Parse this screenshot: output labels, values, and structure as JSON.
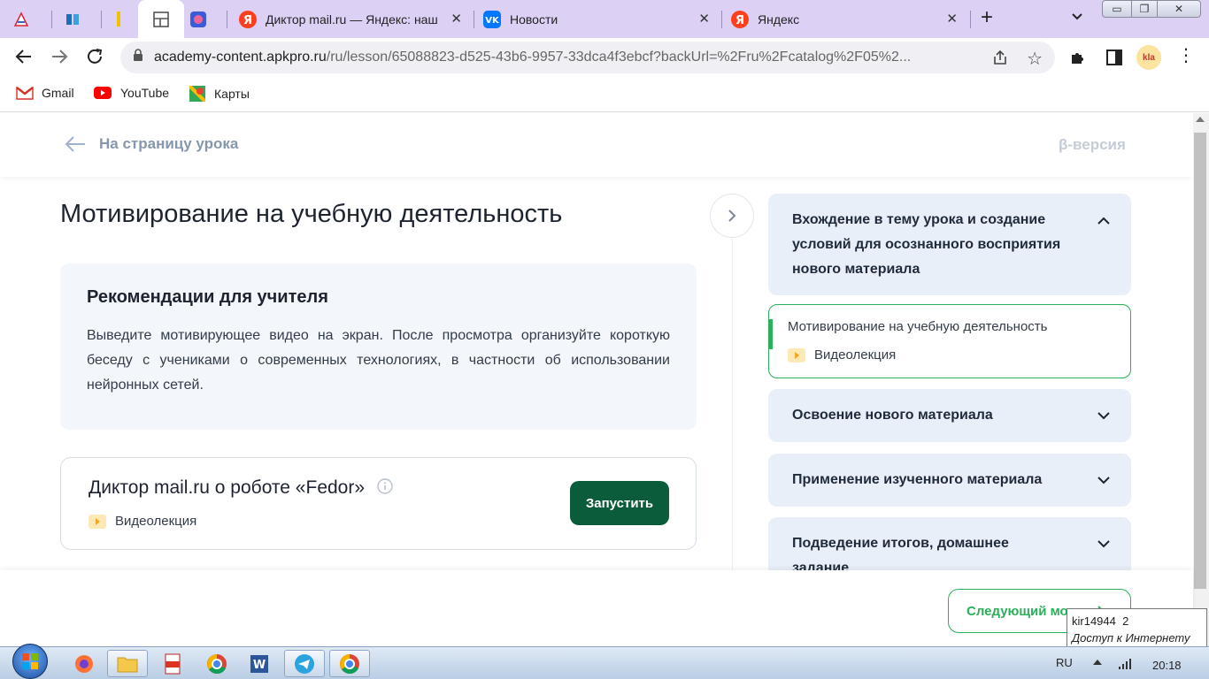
{
  "browser": {
    "tabs": [
      {
        "title": "",
        "icon": "app-icon"
      },
      {
        "title": "",
        "icon": "book-icon"
      },
      {
        "title": "",
        "icon": "pencil-icon"
      },
      {
        "title": "",
        "icon": "layout-icon"
      },
      {
        "title": "",
        "icon": "image-icon"
      },
      {
        "title": "Диктор mail.ru — Яндекс: наш",
        "icon": "yandex-icon"
      },
      {
        "title": "Новости",
        "icon": "vk-icon"
      },
      {
        "title": "Яндекс",
        "icon": "yandex-icon"
      }
    ],
    "new_tab": "+",
    "url_host": "academy-content.apkpro.ru",
    "url_path": "/ru/lesson/65088823-d525-43b6-9957-33dca4f3ebcf?backUrl=%2Fru%2Fcatalog%2F05%2...",
    "bookmarks": [
      "Gmail",
      "YouTube",
      "Карты"
    ],
    "profile_badge": "kla"
  },
  "header": {
    "back_link": "На страницу урока",
    "beta": "β-версия"
  },
  "lesson": {
    "title": "Мотивирование на учебную деятельность",
    "recommendations": {
      "heading": "Рекомендации для учителя",
      "text": "Выведите мотивирующее видео на экран. После просмотра организуйте короткую беседу с учениками о современных технологиях, в частности об использовании нейронных сетей."
    },
    "resource": {
      "title": "Диктор mail.ru о роботе «Fedor»",
      "type": "Видеолекция",
      "button": "Запустить"
    }
  },
  "sidebar": {
    "sections": [
      {
        "title": "Вхождение в тему урока и создание условий для осознанного восприятия нового материала",
        "expanded": true
      },
      {
        "title": "Освоение нового материала",
        "expanded": false
      },
      {
        "title": "Применение изученного материала",
        "expanded": false
      },
      {
        "title": "Подведение итогов, домашнее задание",
        "expanded": false
      }
    ],
    "active_item": {
      "title": "Мотивирование на учебную деятельность",
      "type": "Видеолекция"
    }
  },
  "footer": {
    "next_button": "Следующий мод"
  },
  "tooltip": {
    "line1": "kir14944  2",
    "line2": "Доступ к Интернету"
  },
  "taskbar": {
    "lang": "RU",
    "time": "20:18"
  },
  "colors": {
    "accent_green": "#0b5c3a",
    "section_bg": "#e9eff8",
    "active_border": "#2bb05a",
    "tab_bar": "#dcd0f5"
  }
}
